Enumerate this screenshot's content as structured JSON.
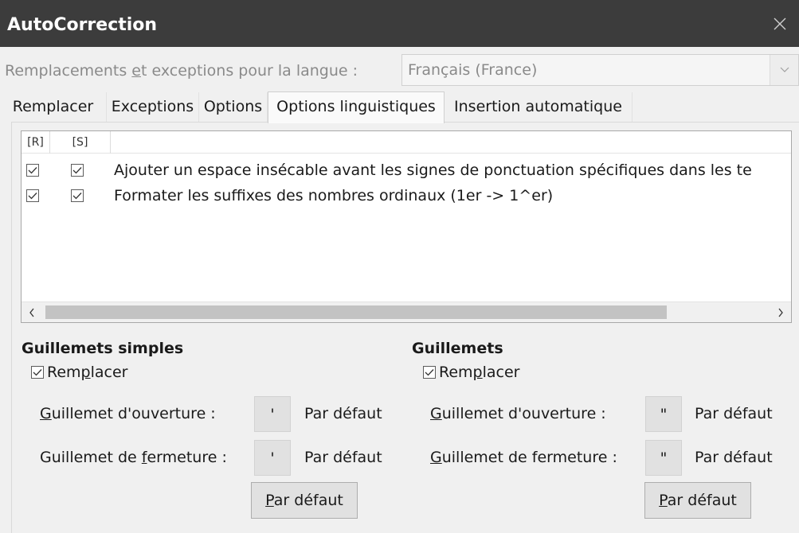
{
  "window": {
    "title": "AutoCorrection"
  },
  "language": {
    "label_pre": "Remplacements ",
    "label_mnemonic": "e",
    "label_post": "t exceptions pour la langue :",
    "selected": "Français (France)"
  },
  "tabs": [
    {
      "label": "Remplacer",
      "active": false
    },
    {
      "label": "Exceptions",
      "active": false
    },
    {
      "label": "Options",
      "active": false
    },
    {
      "label": "Options linguistiques",
      "active": true
    },
    {
      "label": "Insertion automatique",
      "active": false
    }
  ],
  "options_list": {
    "columns": [
      "[R]",
      "[S]"
    ],
    "rows": [
      {
        "r": true,
        "s": true,
        "text": "Ajouter un espace insécable avant les signes de ponctuation spécifiques dans les te"
      },
      {
        "r": true,
        "s": true,
        "text": "Formater les suffixes des nombres ordinaux (1er -> 1^er)"
      }
    ]
  },
  "single_quotes": {
    "title": "Guillemets simples",
    "replace": {
      "checked": true,
      "pre": "Rem",
      "mnemonic": "p",
      "post": "lacer"
    },
    "opening": {
      "mnemonic": "G",
      "post": "uillemet d'ouverture :",
      "char": "'",
      "default_text": "Par défaut"
    },
    "closing": {
      "pre": "Guillemet de ",
      "mnemonic": "f",
      "post": "ermeture :",
      "char": "'",
      "default_text": "Par défaut"
    },
    "default_button": {
      "mnemonic": "P",
      "post": "ar défaut"
    }
  },
  "double_quotes": {
    "title": "Guillemets",
    "replace": {
      "checked": true,
      "pre": "Rem",
      "mnemonic": "p",
      "post": "lacer"
    },
    "opening": {
      "mnemonic": "G",
      "post": "uillemet d'ouverture :",
      "char": "\"",
      "default_text": "Par défaut"
    },
    "closing": {
      "mnemonic": "G",
      "post": "uillemet de fermeture :",
      "char": "\"",
      "default_text": "Par défaut"
    },
    "default_button": {
      "mnemonic": "P",
      "post": "ar défaut"
    }
  }
}
